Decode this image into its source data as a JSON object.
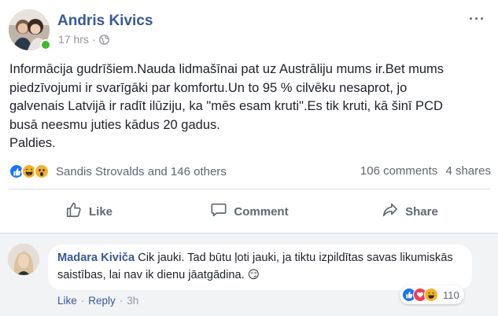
{
  "post": {
    "author": "Andris Kivics",
    "time": "17 hrs",
    "separator": "·",
    "more": "···",
    "text_lines": [
      "Informācija gudrīšiem.Nauda lidmašīnai pat uz Austrāliju mums ir.Bet mums",
      "piedzīvojumi ir svarīgāki par komfortu.Un to 95 % cilvēku nesaprot, jo",
      "galvenais Latvijā ir radīt ilūziju, ka \"mēs esam kruti\".Es tik kruti, kā šinī PCD",
      "busā neesmu juties kādus 20 gadus.",
      "Paldies."
    ]
  },
  "reactions": {
    "names": "Sandis Strovalds and 146 others",
    "comments": "106 comments",
    "shares": "4 shares",
    "icons": [
      "like-icon",
      "haha-icon",
      "wow-icon"
    ]
  },
  "actions": {
    "like": "Like",
    "comment": "Comment",
    "share": "Share"
  },
  "comment": {
    "author": "Madara Kiviča",
    "text": "Cik jauki. Tad būtu ļoti jauki, ja tiktu izpildītas savas likumiskās saistības, lai nav ik dienu jāatgādina. 😏",
    "reaction_count": "110",
    "like": "Like",
    "reply": "Reply",
    "dot": "·",
    "time": "3h"
  },
  "colors": {
    "link_blue": "#385898",
    "like_blue": "#1877f2",
    "emoji_yellow": "#f7b125",
    "love_red": "#f33e58",
    "online_green": "#42b72a"
  }
}
